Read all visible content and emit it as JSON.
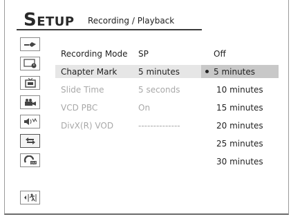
{
  "header": {
    "title_initial": "S",
    "title_rest": "ETUP",
    "subtitle": "Recording / Playback"
  },
  "sidebar": {
    "icons": [
      {
        "name": "tv-antenna-icon"
      },
      {
        "name": "clock-display-icon"
      },
      {
        "name": "tv-screen-icon"
      },
      {
        "name": "video-camera-icon"
      },
      {
        "name": "audio-speaker-icon"
      },
      {
        "name": "recording-playback-arrows-icon",
        "active": true
      },
      {
        "name": "dvd-disc-icon"
      },
      {
        "name": "exit-icon"
      }
    ]
  },
  "settings": [
    {
      "label": "Recording Mode",
      "value": "SP",
      "state": "normal"
    },
    {
      "label": "Chapter Mark",
      "value": "5 minutes",
      "state": "highlighted"
    },
    {
      "label": "Slide Time",
      "value": "5 seconds",
      "state": "dimmed"
    },
    {
      "label": "VCD PBC",
      "value": "On",
      "state": "dimmed"
    },
    {
      "label": "DivX(R) VOD",
      "value": "--------------",
      "state": "dimmed"
    }
  ],
  "options": {
    "items": [
      "Off",
      "5 minutes",
      "10 minutes",
      "15 minutes",
      "20 minutes",
      "25 minutes",
      "30 minutes"
    ],
    "selected": "5 minutes"
  },
  "colors": {
    "highlight_row": "#e6e6e6",
    "selected_option": "#c8c8c8",
    "dimmed_text": "#a8a8a8"
  }
}
